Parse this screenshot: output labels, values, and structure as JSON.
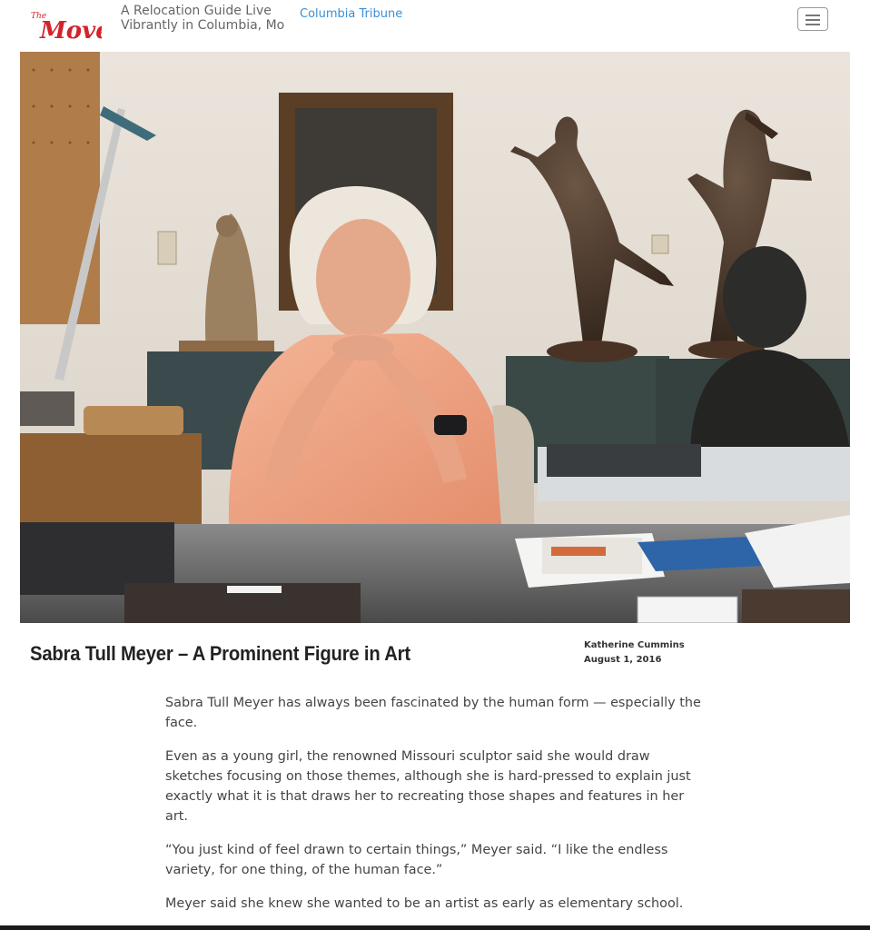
{
  "header": {
    "logo_alt": "The Move",
    "tagline_line1": "A Relocation Guide Live",
    "tagline_line2": "Vibrantly in Columbia, Mo",
    "tribune_link": "Columbia Tribune",
    "menu_icon": "hamburger-menu-icon"
  },
  "colors": {
    "logo_red": "#d2232a",
    "link_blue": "#3a8fd6",
    "headline": "#222222",
    "body_text": "#444444"
  },
  "hero": {
    "description_icon": "photo"
  },
  "article": {
    "title": "Sabra Tull Meyer – A Prominent Figure in Art",
    "author": "Katherine Cummins",
    "date": "August 1, 2016",
    "paragraphs": [
      "Sabra Tull Meyer has always been fascinated by the human form — especially the face.",
      "Even as a young girl, the renowned Missouri sculptor said she would draw sketches focusing on those themes, although she is hard-pressed to explain just exactly what it is that draws her to recreating those shapes and features in her art.",
      "“You just kind of feel drawn to certain things,” Meyer said. “I like the endless variety, for one thing, of the human face.”",
      "Meyer said she knew she wanted to be an artist as early as elementary school."
    ]
  }
}
